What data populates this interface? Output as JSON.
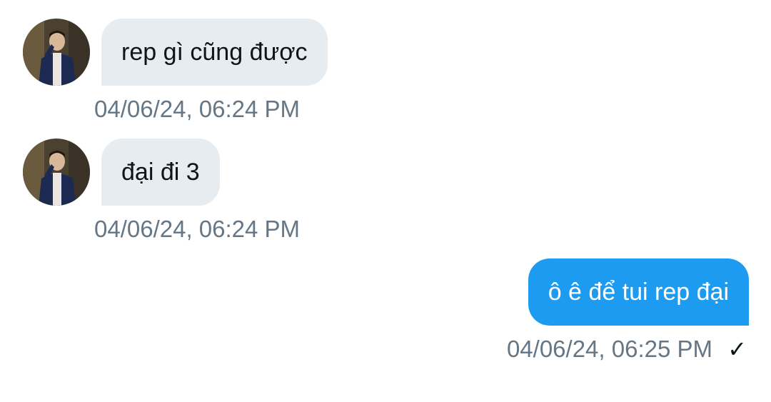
{
  "conversation": {
    "messages": [
      {
        "direction": "received",
        "text": "rep gì cũng được",
        "timestamp": "04/06/24, 06:24 PM",
        "avatar": "user-avatar"
      },
      {
        "direction": "received",
        "text": "đại đi 3",
        "timestamp": "04/06/24, 06:24 PM",
        "avatar": "user-avatar"
      },
      {
        "direction": "sent",
        "text": "ô ê để tui rep đại",
        "timestamp": "04/06/24, 06:25 PM",
        "status_icon": "checkmark-icon",
        "status_glyph": "✓"
      }
    ]
  },
  "colors": {
    "received_bubble": "#e7ecf0",
    "sent_bubble": "#1d9bf0",
    "timestamp": "#657786",
    "text": "#0f1419"
  }
}
